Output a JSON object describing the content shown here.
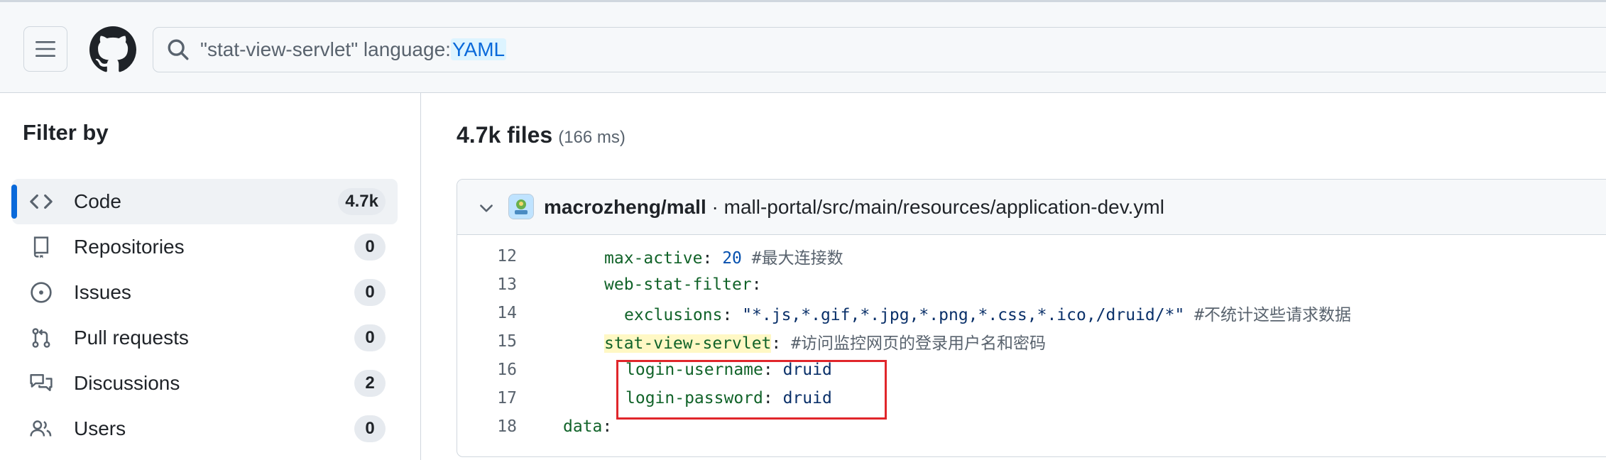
{
  "header": {
    "search": {
      "query_text": "\"stat-view-servlet\" language:",
      "qualifier": "YAML"
    }
  },
  "sidebar": {
    "title": "Filter by",
    "items": [
      {
        "label": "Code",
        "count": "4.7k",
        "icon": "code-icon",
        "active": true
      },
      {
        "label": "Repositories",
        "count": "0",
        "icon": "repo-icon"
      },
      {
        "label": "Issues",
        "count": "0",
        "icon": "issue-icon"
      },
      {
        "label": "Pull requests",
        "count": "0",
        "icon": "pull-request-icon"
      },
      {
        "label": "Discussions",
        "count": "2",
        "icon": "discussion-icon"
      },
      {
        "label": "Users",
        "count": "0",
        "icon": "people-icon"
      }
    ]
  },
  "results": {
    "count": "4.7k files",
    "time": "(166 ms)"
  },
  "result_card": {
    "repo": "macrozheng/mall",
    "path": " · mall-portal/src/main/resources/application-dev.yml",
    "lines": [
      {
        "num": "12",
        "key": "max-active",
        "sep": ": ",
        "num_val": "20",
        "comment": " #最大连接数"
      },
      {
        "num": "13",
        "key": "web-stat-filter",
        "sep": ":"
      },
      {
        "num": "14",
        "key": "exclusions",
        "sep": ": ",
        "str_val": "\"*.js,*.gif,*.jpg,*.png,*.css,*.ico,/druid/*\"",
        "comment": " #不统计这些请求数据"
      },
      {
        "num": "15",
        "key": "stat-view-servlet",
        "sep": ": ",
        "comment": "#访问监控网页的登录用户名和密码"
      },
      {
        "num": "16",
        "key": "login-username",
        "sep": ": ",
        "str_val": "druid"
      },
      {
        "num": "17",
        "key": "login-password",
        "sep": ": ",
        "str_val": "druid"
      },
      {
        "num": "18",
        "key": "data",
        "sep": ":"
      }
    ]
  },
  "colors": {
    "accent": "#0969da",
    "highlight_box": "#e0262b",
    "match_highlight": "#fff8c5"
  }
}
